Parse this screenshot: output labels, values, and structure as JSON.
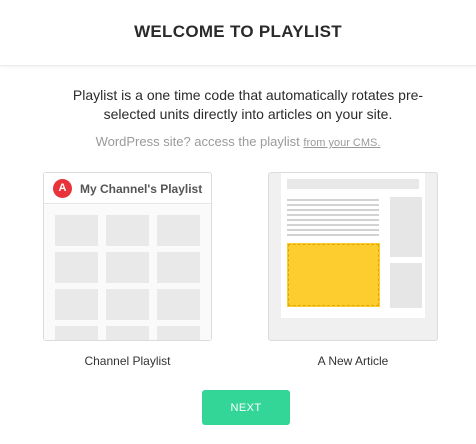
{
  "header": {
    "title": "WELCOME TO PLAYLIST"
  },
  "intro": {
    "text": "Playlist is a one time code that automatically rotates pre-selected units directly into articles on your site."
  },
  "wordpress": {
    "prefix": "WordPress site? access the playlist ",
    "link_label": "from your CMS."
  },
  "cards": {
    "channel": {
      "logo_letter": "A",
      "title": "My Channel's Playlist",
      "label": "Channel Playlist"
    },
    "article": {
      "label": "A New Article"
    }
  },
  "actions": {
    "next_label": "NEXT"
  },
  "colors": {
    "accent": "#33d697",
    "logo_red": "#e8333b",
    "highlight_yellow": "#fdcd2f"
  }
}
